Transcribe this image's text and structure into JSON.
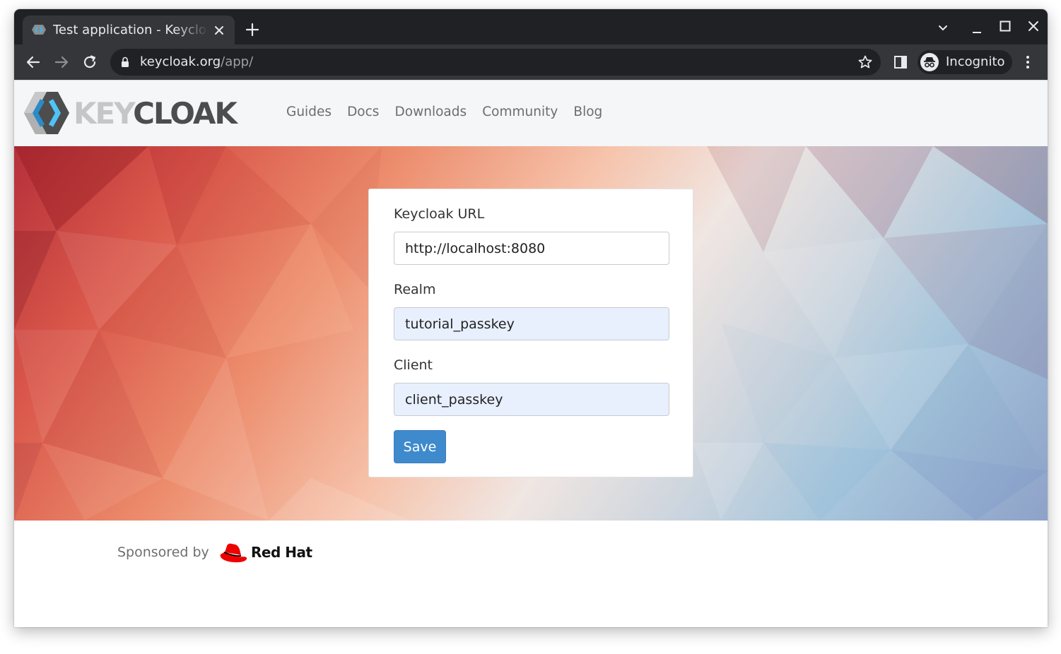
{
  "browser": {
    "tab_title": "Test application - Keycloak",
    "url_host": "keycloak.org",
    "url_path": "/app/",
    "incognito_label": "Incognito",
    "icons": [
      "keycloak-favicon",
      "close-icon",
      "plus-icon",
      "chevron-down-icon",
      "minimize-icon",
      "maximize-icon",
      "close-window-icon",
      "back-arrow-icon",
      "forward-arrow-icon",
      "reload-icon",
      "lock-icon",
      "star-icon",
      "side-panel-icon",
      "incognito-icon",
      "kebab-menu-icon"
    ]
  },
  "site": {
    "logo_key": "KEY",
    "logo_cloak": "CLOAK",
    "nav": [
      "Guides",
      "Docs",
      "Downloads",
      "Community",
      "Blog"
    ]
  },
  "form": {
    "url_label": "Keycloak URL",
    "url_value": "http://localhost:8080",
    "realm_label": "Realm",
    "realm_value": "tutorial_passkey",
    "client_label": "Client",
    "client_value": "client_passkey",
    "save_label": "Save"
  },
  "footer": {
    "sponsored_by": "Sponsored by",
    "sponsor_name": "Red Hat"
  },
  "colors": {
    "chrome_dark": "#202124",
    "chrome_toolbar": "#35363a",
    "header_bg": "#f4f6f8",
    "save_button": "#3f8acc",
    "autofill_bg": "#e8f0fe",
    "redhat_red": "#ee0000"
  }
}
